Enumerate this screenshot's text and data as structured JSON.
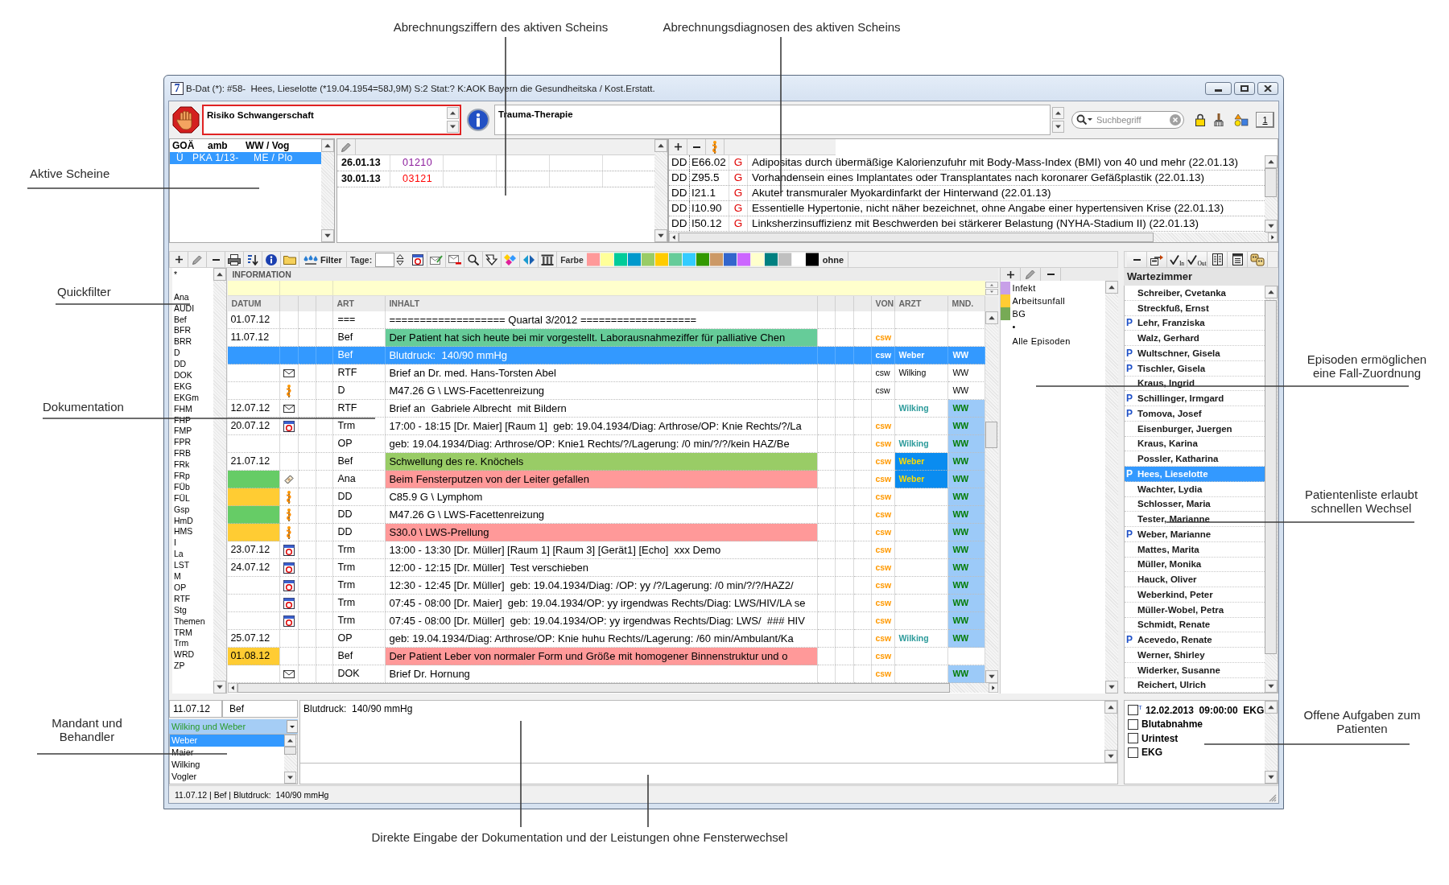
{
  "annotations": [
    {
      "lines": [
        "Abrechnungsziffern des aktiven Scheins"
      ]
    },
    {
      "lines": [
        "Abrechnungsdiagnosen des aktiven Scheins"
      ]
    },
    {
      "lines": [
        "Aktive Scheine"
      ]
    },
    {
      "lines": [
        "Quickfilter"
      ]
    },
    {
      "lines": [
        "Dokumentation"
      ]
    },
    {
      "lines": [
        "Mandant und",
        "Behandler"
      ]
    },
    {
      "lines": [
        "Episoden ermöglichen",
        "eine Fall-Zuordnung"
      ]
    },
    {
      "lines": [
        "Patientenliste erlaubt",
        "schnellen Wechsel"
      ]
    },
    {
      "lines": [
        "Offene Aufgaben zum",
        "Patienten"
      ]
    },
    {
      "lines": [
        "Direkte Eingabe der Dokumentation und der Leistungen ohne Fensterwechsel"
      ]
    }
  ],
  "window": {
    "app_badge": "7",
    "title": "B-Dat (*): #58-  Hees, Lieselotte (*19.04.1954=58J,9M) S:2 Stat:? K:AOK Bayern die Gesundheitska / Kost.Erstatt."
  },
  "notes": {
    "risk": "Risiko Schwangerschaft",
    "info": "Trauma-Therapie"
  },
  "search": {
    "placeholder": "Suchbegriff"
  },
  "page_button": "1",
  "active_cases": {
    "columns": [
      "GOÄ",
      "amb",
      "WW / Vog"
    ],
    "rows": [
      {
        "cells": [
          "Ü",
          "PKA 1/13-",
          "ME / Plo"
        ],
        "selected": true
      }
    ]
  },
  "billing_codes": [
    {
      "date": "26.01.13",
      "code": "01210",
      "color": "#8b1a9b"
    },
    {
      "date": "30.01.13",
      "code": "03121",
      "color": "#ff0000"
    }
  ],
  "diagnoses": [
    {
      "type": "DD",
      "code": "E66.02",
      "certainty": "G",
      "text": "Adipositas durch übermäßige Kalorienzufuhr mit Body-Mass-Index (BMI) von 40 und mehr (22.01.13)"
    },
    {
      "type": "DD",
      "code": "Z95.5",
      "certainty": "G",
      "text": "Vorhandensein eines Implantates oder Transplantates nach koronarer Gefäßplastik (22.01.13)"
    },
    {
      "type": "DD",
      "code": "I21.1",
      "certainty": "G",
      "text": "Akuter transmuraler Myokardinfarkt der Hinterwand (22.01.13)"
    },
    {
      "type": "DD",
      "code": "I10.90",
      "certainty": "G",
      "text": "Essentielle Hypertonie, nicht näher bezeichnet, ohne Angabe einer hypertensiven Krise (22.01.13)"
    },
    {
      "type": "DD",
      "code": "I50.12",
      "certainty": "G",
      "text": "Linksherzinsuffizienz mit Beschwerden bei stärkerer Belastung (NYHA-Stadium II) (22.01.13)"
    }
  ],
  "toolbar": {
    "filter": "Filter",
    "days_label": "Tage:",
    "color_label": "Farbe",
    "swatches": [
      {
        "color": "#ff9999"
      },
      {
        "color": "#ffff99"
      },
      {
        "color": "#00cc99"
      },
      {
        "color": "#0099cc"
      },
      {
        "color": "#99cc66"
      },
      {
        "color": "#ffcc00"
      },
      {
        "color": "#66cc99"
      },
      {
        "color": "#33ccff"
      },
      {
        "color": "#339900"
      },
      {
        "color": "#cc9966"
      },
      {
        "color": "#3366cc"
      },
      {
        "color": "#cc66ff"
      },
      {
        "color": "#ffffcc"
      },
      {
        "color": "#008080"
      },
      {
        "color": "#c0c0c0"
      },
      {
        "color": "#ffffff"
      },
      {
        "color": "#000000"
      }
    ],
    "none": "ohne"
  },
  "quickfilter": [
    "*",
    "Ana",
    "AUDI",
    "Bef",
    "BFR",
    "BRR",
    "D",
    "DD",
    "DOK",
    "EKG",
    "EKGm",
    "FHM",
    "FHP",
    "FMP",
    "FPR",
    "FRB",
    "FRk",
    "FRp",
    "FÜb",
    "FÜL",
    "Gsp",
    "HmD",
    "HMS",
    "I",
    "La",
    "LST",
    "M",
    "OP",
    "RTF",
    "Stg",
    "Themen",
    "TRM",
    "Trm",
    "WRD",
    "ZP"
  ],
  "documentation": {
    "info_header": "INFORMATION",
    "columns": [
      "DATUM",
      "ART",
      "INHALT",
      "VON",
      "ARZT",
      "MND."
    ],
    "rows": [
      {
        "date": "01.07.12",
        "kind": "note",
        "art": "===",
        "content": "=================== Quartal 3/2012 ===================",
        "selected": false
      },
      {
        "date": "11.07.12",
        "kind": "note",
        "art": "Bef",
        "content": "Der Patient hat sich heute bei mir vorgestellt. Laborausnahmeziffer für palliative Chen",
        "color": "#66cc99",
        "staff": {
          "von": "csw",
          "plain": false,
          "arzt_highlight": false
        },
        "selected": false
      },
      {
        "kind": "note",
        "art": "Bef",
        "content": "Blutdruck:  140/90 mmHg",
        "staff": {
          "von": "csw",
          "arzt": "Weber",
          "mnd": "WW",
          "plain": false,
          "arzt_highlight": false
        },
        "selected": true
      },
      {
        "kind": "letter",
        "art": "RTF",
        "content": "Brief an Dr. med. Hans-Torsten Abel",
        "staff": {
          "von": "csw",
          "arzt": "Wilking",
          "mnd": "WW",
          "plain": true,
          "arzt_highlight": false
        },
        "selected": false
      },
      {
        "kind": "diagnosis",
        "art": "D",
        "content": "M47.26 G \\ LWS-Facettenreizung",
        "staff": {
          "von": "csw",
          "mnd": "WW",
          "plain": true,
          "arzt_highlight": false
        },
        "selected": false
      },
      {
        "date": "12.07.12",
        "kind": "letter",
        "art": "RTF",
        "content": "Brief an  Gabriele Albrecht  mit Bildern",
        "staff": {
          "arzt": "Wilking",
          "mnd": "WW",
          "plain": false,
          "arzt_highlight": false
        },
        "selected": false
      },
      {
        "date": "20.07.12",
        "kind": "appointment",
        "art": "Trm",
        "content": "17:00 - 18:15 [Dr. Maier] [Raum 1]  geb: 19.04.1934/Diag: Arthrose/OP: Knie Rechts/?/La",
        "staff": {
          "von": "csw",
          "mnd": "WW",
          "plain": false,
          "arzt_highlight": false
        },
        "selected": false
      },
      {
        "kind": "note",
        "art": "OP",
        "content": "geb: 19.04.1934/Diag: Arthrose/OP: Knie1 Rechts/?/Lagerung: /0 min/?/?/kein HAZ/Be",
        "staff": {
          "von": "csw",
          "arzt": "Wilking",
          "mnd": "WW",
          "plain": false,
          "arzt_highlight": false
        },
        "selected": false
      },
      {
        "date": "21.07.12",
        "kind": "note",
        "art": "Bef",
        "content": "Schwellung des re. Knöchels",
        "color": "#99cc66",
        "staff": {
          "von": "csw",
          "arzt": "Weber",
          "mnd": "WW",
          "plain": false,
          "arzt_highlight": true
        },
        "selected": false
      },
      {
        "episode": {
          "color": "#66cc66"
        },
        "kind": "accident",
        "art": "Ana",
        "content": "Beim Fensterputzen von der Leiter gefallen",
        "color": "#ff9999",
        "staff": {
          "von": "csw",
          "arzt": "Weber",
          "mnd": "WW",
          "plain": false,
          "arzt_highlight": true
        },
        "selected": false
      },
      {
        "episode": {
          "color": "#ffcc33"
        },
        "kind": "diagnosis",
        "art": "DD",
        "content": "C85.9 G \\ Lymphom",
        "staff": {
          "von": "csw",
          "mnd": "WW",
          "plain": false,
          "arzt_highlight": false
        },
        "selected": false
      },
      {
        "episode": {
          "color": "#66cc66"
        },
        "kind": "diagnosis",
        "art": "DD",
        "content": "M47.26 G \\ LWS-Facettenreizung",
        "staff": {
          "von": "csw",
          "mnd": "WW",
          "plain": false,
          "arzt_highlight": false
        },
        "selected": false
      },
      {
        "episode": {
          "color": "#ffcc33"
        },
        "kind": "diagnosis",
        "art": "DD",
        "content": "S30.0 \\ LWS-Prellung",
        "color": "#ff9999",
        "staff": {
          "von": "csw",
          "mnd": "WW",
          "plain": false,
          "arzt_highlight": false
        },
        "selected": false
      },
      {
        "date": "23.07.12",
        "kind": "appointment",
        "art": "Trm",
        "content": "13:00 - 13:30 [Dr. Müller] [Raum 1] [Raum 3] [Gerät1] [Echo]  xxx Demo",
        "staff": {
          "von": "csw",
          "mnd": "WW",
          "plain": false,
          "arzt_highlight": false
        },
        "selected": false
      },
      {
        "date": "24.07.12",
        "kind": "appointment",
        "art": "Trm",
        "content": "12:00 - 12:15 [Dr. Müller]  Test verschieben",
        "staff": {
          "von": "csw",
          "mnd": "WW",
          "plain": false,
          "arzt_highlight": false
        },
        "selected": false
      },
      {
        "kind": "appointment",
        "art": "Trm",
        "content": "12:30 - 12:45 [Dr. Müller]  geb: 19.04.1934/Diag: /OP: yy /?/Lagerung: /0 min/?/?/HAZ2/",
        "staff": {
          "von": "csw",
          "mnd": "WW",
          "plain": false,
          "arzt_highlight": false
        },
        "selected": false
      },
      {
        "kind": "appointment",
        "art": "Trm",
        "content": "07:45 - 08:00 [Dr. Maier]  geb: 19.04.1934/OP: yy irgendwas Rechts/Diag: LWS/HIV/LA se",
        "staff": {
          "von": "csw",
          "mnd": "WW",
          "plain": false,
          "arzt_highlight": false
        },
        "selected": false
      },
      {
        "kind": "appointment",
        "art": "Trm",
        "content": "07:45 - 08:00 [Dr. Müller]  geb: 19.04.1934/OP: yy irgendwas Rechts/Diag: LWS/  ### HIV",
        "staff": {
          "von": "csw",
          "mnd": "WW",
          "plain": false,
          "arzt_highlight": false
        },
        "selected": false
      },
      {
        "date": "25.07.12",
        "kind": "note",
        "art": "OP",
        "content": "geb: 19.04.1934/Diag: Arthrose/OP: Knie huhu Rechts//Lagerung: /60 min/Ambulant/Ka",
        "staff": {
          "von": "csw",
          "arzt": "Wilking",
          "mnd": "WW",
          "plain": false,
          "arzt_highlight": false
        },
        "selected": false
      },
      {
        "date": "01.08.12",
        "episode": {
          "color": "#ffcc33"
        },
        "kind": "note",
        "art": "Bef",
        "content": "Der Patient Leber von normaler Form und Größe mit homogener Binnenstruktur und o",
        "color": "#ff9999",
        "staff": {
          "von": "csw",
          "plain": false,
          "arzt_highlight": false
        },
        "selected": false
      },
      {
        "kind": "letter",
        "art": "DOK",
        "content": "Brief Dr. Hornung",
        "staff": {
          "von": "csw",
          "mnd": "WW",
          "plain": false,
          "arzt_highlight": false
        },
        "selected": false
      }
    ]
  },
  "episodes": [
    {
      "kind": "episode",
      "label": "Infekt",
      "color": "#c8a0e8"
    },
    {
      "kind": "episode",
      "label": "Arbeitsunfall",
      "color": "#ffcc33"
    },
    {
      "kind": "episode",
      "label": "BG",
      "color": "#77aa55"
    },
    {
      "kind": "blank",
      "label": "•"
    },
    {
      "kind": "all",
      "label": "Alle Episoden"
    }
  ],
  "waiting_room": {
    "title": "Wartezimmer",
    "checkin_label": "In",
    "checkout_label": "Out",
    "patients": [
      {
        "name": "Schreiber, Cvetanka",
        "selected": false
      },
      {
        "name": "Streckfuß, Ernst",
        "selected": false
      },
      {
        "flag": "P",
        "name": "Lehr, Franziska",
        "selected": false
      },
      {
        "name": "Walz, Gerhard",
        "selected": false
      },
      {
        "flag": "P",
        "name": "Wultschner, Gisela",
        "selected": false
      },
      {
        "flag": "P",
        "name": "Tischler, Gisela",
        "selected": false
      },
      {
        "name": "Kraus, Ingrid",
        "selected": false
      },
      {
        "flag": "P",
        "name": "Schillinger, Irmgard",
        "selected": false
      },
      {
        "flag": "P",
        "name": "Tomova, Josef",
        "selected": false
      },
      {
        "name": "Eisenburger, Juergen",
        "selected": false
      },
      {
        "name": "Kraus, Karina",
        "selected": false
      },
      {
        "name": "Possler, Katharina",
        "selected": false
      },
      {
        "flag": "P",
        "name": "Hees, Lieselotte",
        "selected": true
      },
      {
        "name": "Wachter, Lydia",
        "selected": false
      },
      {
        "name": "Schlosser, Maria",
        "selected": false
      },
      {
        "name": "Tester, Marianne",
        "selected": false
      },
      {
        "flag": "P",
        "name": "Weber, Marianne",
        "selected": false
      },
      {
        "name": "Mattes, Marita",
        "selected": false
      },
      {
        "name": "Müller, Monika",
        "selected": false
      },
      {
        "name": "Hauck, Oliver",
        "selected": false
      },
      {
        "name": "Weberkind, Peter",
        "selected": false
      },
      {
        "name": "Müller-Wobel, Petra",
        "selected": false
      },
      {
        "name": "Schmidt, Renate",
        "selected": false
      },
      {
        "flag": "P",
        "name": "Acevedo, Renate",
        "selected": false
      },
      {
        "name": "Werner, Shirley",
        "selected": false
      },
      {
        "name": "Widerker, Susanne",
        "selected": false
      },
      {
        "name": "Reichert, Ulrich",
        "selected": false
      }
    ]
  },
  "entry": {
    "date": "11.07.12",
    "art": "Bef",
    "content": "Blutdruck:  140/90 mmHg"
  },
  "mandant": {
    "value": "Wilking und Weber"
  },
  "behandler": [
    {
      "name": "Weber",
      "selected": true
    },
    {
      "name": "Maier",
      "selected": false
    },
    {
      "name": "Wilking",
      "selected": false
    },
    {
      "name": "Vogler",
      "selected": false
    }
  ],
  "tasks": [
    {
      "marker": "T",
      "text": "12.02.2013  09:00:00  EKG",
      "checked": false
    },
    {
      "text": "Blutabnahme",
      "checked": false
    },
    {
      "text": "Urintest",
      "checked": false
    },
    {
      "text": "EKG",
      "checked": false
    }
  ],
  "status_bar": "11.07.12 | Bef | Blutdruck:  140/90 mmHg"
}
